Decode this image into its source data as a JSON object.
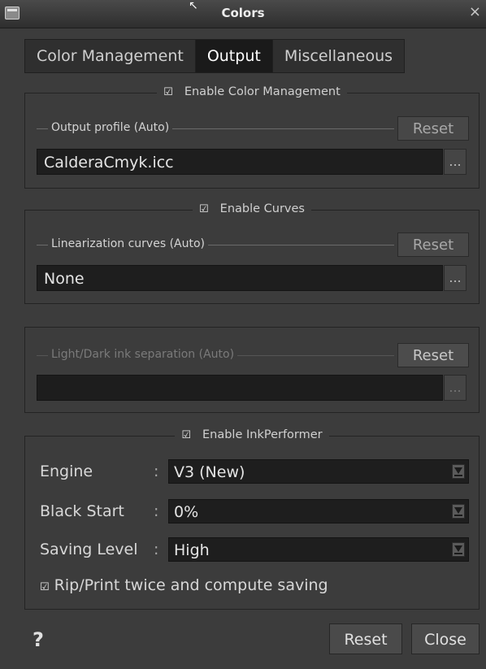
{
  "window": {
    "title": "Colors",
    "close_glyph": "×"
  },
  "tabs": [
    {
      "label": "Color Management",
      "active": false
    },
    {
      "label": "Output",
      "active": true
    },
    {
      "label": "Miscellaneous",
      "active": false
    }
  ],
  "color_management": {
    "legend": "Enable Color Management",
    "checked": true,
    "sub_label": "Output profile (Auto)",
    "reset_label": "Reset",
    "value": "CalderaCmyk.icc",
    "browse_label": "..."
  },
  "curves": {
    "legend": "Enable Curves",
    "checked": true,
    "sub_label": "Linearization curves (Auto)",
    "reset_label": "Reset",
    "value": "None",
    "browse_label": "..."
  },
  "ink_separation": {
    "sub_label": "Light/Dark ink separation (Auto)",
    "reset_label": "Reset",
    "value": "",
    "browse_label": "..."
  },
  "inkperformer": {
    "legend": "Enable InkPerformer",
    "checked": true,
    "separator": ":",
    "rows": [
      {
        "label": "Engine",
        "value": "V3 (New)"
      },
      {
        "label": "Black Start",
        "value": "0%"
      },
      {
        "label": "Saving Level",
        "value": "High"
      }
    ],
    "checkbox_label": "Rip/Print twice and compute saving",
    "checkbox_checked": true
  },
  "footer": {
    "help_label": "?",
    "reset_label": "Reset",
    "close_label": "Close"
  },
  "check_glyph": "☑"
}
